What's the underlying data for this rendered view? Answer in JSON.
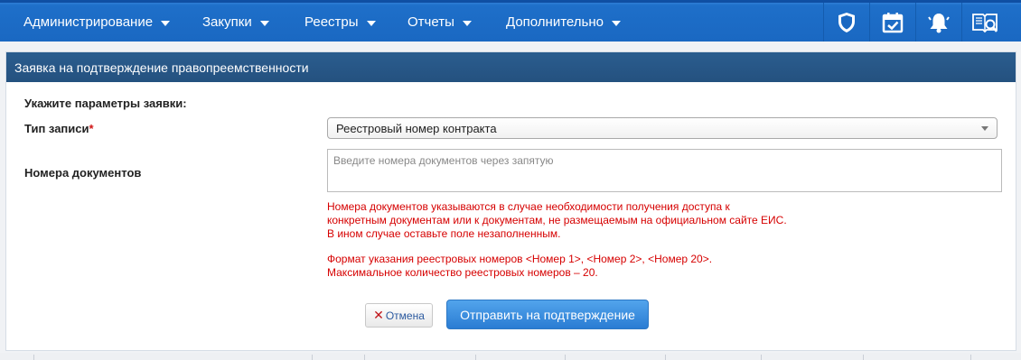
{
  "nav": {
    "menu": [
      {
        "label": "Администрирование"
      },
      {
        "label": "Закупки"
      },
      {
        "label": "Реестры"
      },
      {
        "label": "Отчеты"
      },
      {
        "label": "Дополнительно"
      }
    ],
    "icons": [
      "shield-icon",
      "calendar-check-icon",
      "bell-icon",
      "book-search-icon"
    ]
  },
  "panel": {
    "title": "Заявка на подтверждение правопреемственности"
  },
  "form": {
    "section_label": "Укажите параметры заявки:",
    "type_label": "Тип записи",
    "required_mark": "*",
    "type_value": "Реестровый номер контракта",
    "docs_label": "Номера документов",
    "docs_placeholder": "Введите номера документов через запятую",
    "hint_lines_1": [
      "Номера документов указываются в случае необходимости получения доступа к",
      "конкретным документам или к документам, не размещаемым на официальном сайте ЕИС.",
      "В ином случае оставьте поле незаполненным."
    ],
    "hint_lines_2": [
      "Формат указания реестровых номеров <Номер 1>, <Номер 2>, <Номер 20>.",
      "Максимальное количество реестровых номеров – 20."
    ]
  },
  "buttons": {
    "cancel": "Отмена",
    "submit": "Отправить на подтверждение"
  },
  "colors": {
    "topbar": "#1a68c2",
    "panel_header": "#24517f",
    "hint_red": "#d60000",
    "submit_blue": "#2a7cd3"
  }
}
